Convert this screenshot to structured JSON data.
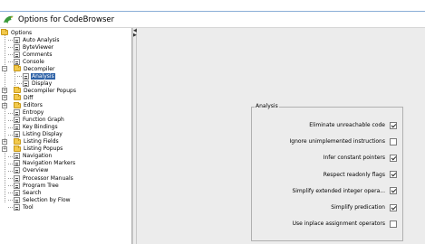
{
  "window": {
    "title": "Options for CodeBrowser"
  },
  "tree": {
    "root": {
      "label": "Options",
      "expanded": true
    },
    "items": [
      {
        "label": "Auto Analysis",
        "type": "leaf",
        "depth": 1
      },
      {
        "label": "ByteViewer",
        "type": "leaf",
        "depth": 1
      },
      {
        "label": "Comments",
        "type": "leaf",
        "depth": 1
      },
      {
        "label": "Console",
        "type": "leaf",
        "depth": 1
      },
      {
        "label": "Decompiler",
        "type": "folder",
        "depth": 1,
        "expanded": true
      },
      {
        "label": "Analysis",
        "type": "leaf",
        "depth": 2,
        "selected": true
      },
      {
        "label": "Display",
        "type": "leaf",
        "depth": 2
      },
      {
        "label": "Decompiler Popups",
        "type": "folder",
        "depth": 1,
        "expanded": false
      },
      {
        "label": "Diff",
        "type": "folder",
        "depth": 1,
        "expanded": false
      },
      {
        "label": "Editors",
        "type": "folder",
        "depth": 1,
        "expanded": false
      },
      {
        "label": "Entropy",
        "type": "leaf",
        "depth": 1
      },
      {
        "label": "Function Graph",
        "type": "leaf",
        "depth": 1
      },
      {
        "label": "Key Bindings",
        "type": "leaf",
        "depth": 1
      },
      {
        "label": "Listing Display",
        "type": "leaf",
        "depth": 1
      },
      {
        "label": "Listing Fields",
        "type": "folder",
        "depth": 1,
        "expanded": false
      },
      {
        "label": "Listing Popups",
        "type": "folder",
        "depth": 1,
        "expanded": false
      },
      {
        "label": "Navigation",
        "type": "leaf",
        "depth": 1
      },
      {
        "label": "Navigation Markers",
        "type": "leaf",
        "depth": 1
      },
      {
        "label": "Overview",
        "type": "leaf",
        "depth": 1
      },
      {
        "label": "Processor Manuals",
        "type": "leaf",
        "depth": 1
      },
      {
        "label": "Program Tree",
        "type": "leaf",
        "depth": 1
      },
      {
        "label": "Search",
        "type": "leaf",
        "depth": 1
      },
      {
        "label": "Selection by Flow",
        "type": "leaf",
        "depth": 1
      },
      {
        "label": "Tool",
        "type": "leaf",
        "depth": 1
      }
    ]
  },
  "analysis": {
    "group_label": "Analysis",
    "options": [
      {
        "label": "Eliminate unreachable code",
        "checked": true
      },
      {
        "label": "Ignore unimplemented instructions",
        "checked": false
      },
      {
        "label": "Infer constant pointers",
        "checked": true
      },
      {
        "label": "Respect readonly flags",
        "checked": true
      },
      {
        "label": "Simplify extended integer opera...",
        "checked": true
      },
      {
        "label": "Simplify predication",
        "checked": true
      },
      {
        "label": "Use inplace assignment operators",
        "checked": false
      }
    ]
  },
  "colors": {
    "selection": "#2f63a7",
    "folder": "#f2c94c",
    "panel_bg": "#ececec",
    "accent_bar": "#8aaed6"
  }
}
